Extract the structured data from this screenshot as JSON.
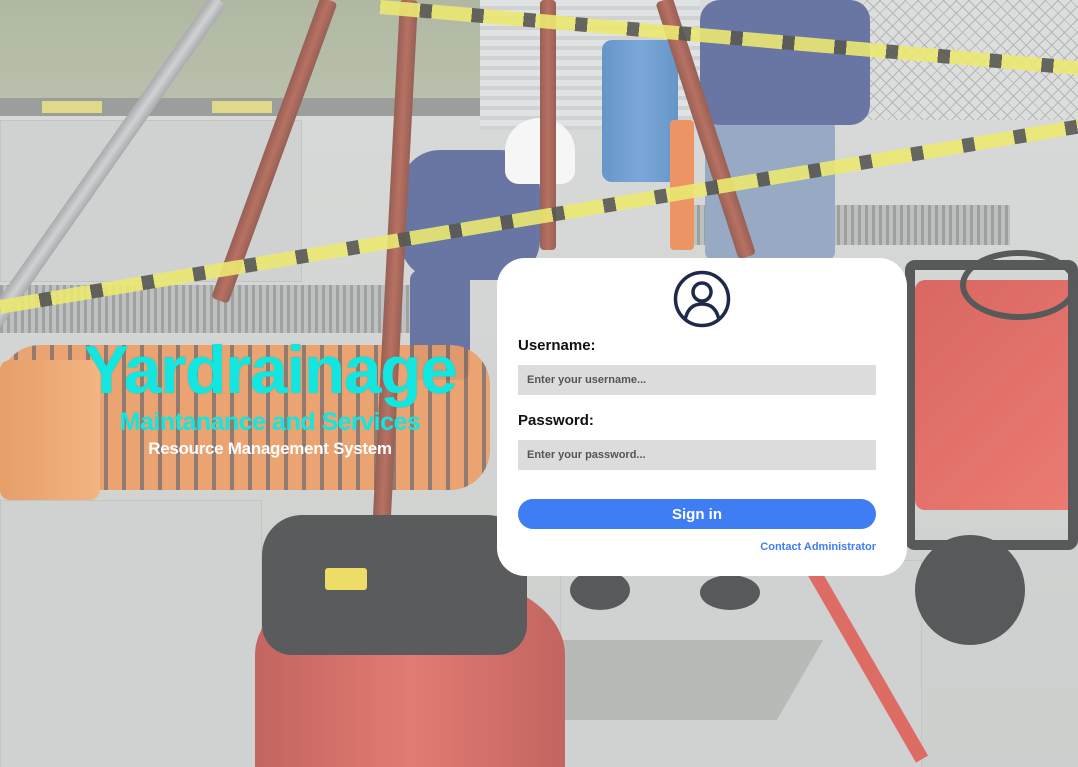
{
  "brand": {
    "title": "Yardrainage",
    "subtitle": "Maintanance and Services",
    "system": "Resource Management System",
    "accent_color": "#12e6e0"
  },
  "login": {
    "avatar_icon": "user-circle-icon",
    "username_label": "Username:",
    "username_placeholder": "Enter your username...",
    "username_value": "",
    "password_label": "Password:",
    "password_placeholder": "Enter your password...",
    "password_value": "",
    "signin_label": "Sign in",
    "contact_label": "Contact Administrator",
    "primary_color": "#3f7df5",
    "icon_color": "#1e2a4a"
  }
}
